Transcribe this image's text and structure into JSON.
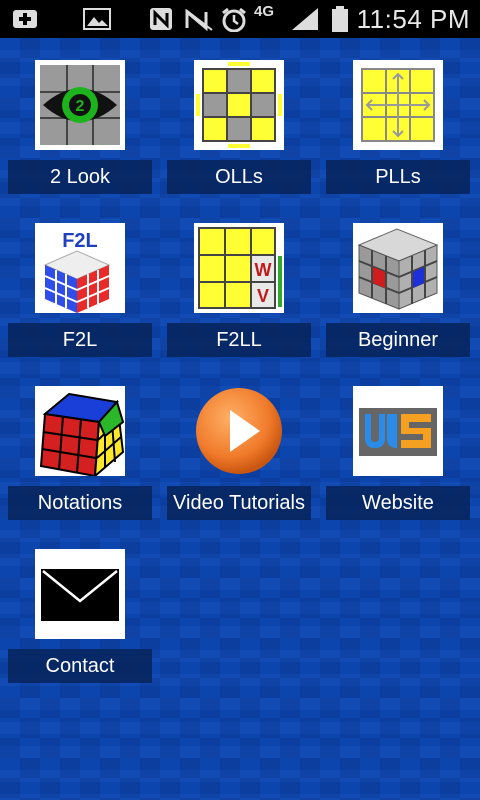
{
  "status_bar": {
    "time": "11:54 PM",
    "network": "4G",
    "icons": [
      "add-icon",
      "image-icon",
      "nfc-icon",
      "no-signal-icon",
      "alarm-icon",
      "signal-icon",
      "battery-icon"
    ]
  },
  "tiles": [
    {
      "label": "2 Look",
      "icon": "eye-icon"
    },
    {
      "label": "OLLs",
      "icon": "oll-grid-icon"
    },
    {
      "label": "PLLs",
      "icon": "pll-arrows-icon"
    },
    {
      "label": "F2L",
      "icon": "f2l-cube-icon",
      "icon_text": "F2L"
    },
    {
      "label": "F2LL",
      "icon": "f2ll-grid-icon",
      "icon_text_1": "W",
      "icon_text_2": "V"
    },
    {
      "label": "Beginner",
      "icon": "gray-cube-icon"
    },
    {
      "label": "Notations",
      "icon": "rubiks-cube-icon"
    },
    {
      "label": "Video Tutorials",
      "icon": "play-icon"
    },
    {
      "label": "Website",
      "icon": "website-logo-icon"
    },
    {
      "label": "Contact",
      "icon": "envelope-icon"
    }
  ],
  "colors": {
    "background": "#0c45ad",
    "label_bg": "#07235a",
    "cube_yellow": "#ffff33",
    "cube_gray": "#9a9a9a",
    "play_orange": "#f07a2a"
  }
}
